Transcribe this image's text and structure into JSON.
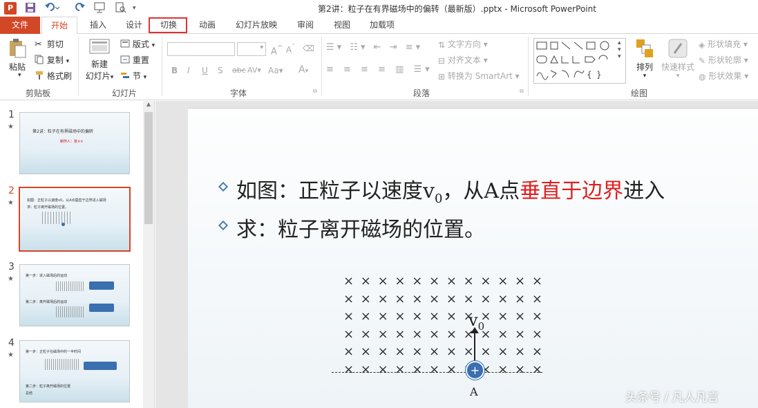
{
  "window": {
    "app_icon_label": "P",
    "title": "第2讲：粒子在有界磁场中的偏转（最新版）.pptx - Microsoft PowerPoint"
  },
  "tabs": [
    "文件",
    "开始",
    "插入",
    "设计",
    "切换",
    "动画",
    "幻灯片放映",
    "审阅",
    "视图",
    "加载项"
  ],
  "ribbon": {
    "clipboard": {
      "paste": "粘贴",
      "cut": "剪切",
      "copy": "复制",
      "format_painter": "格式刷",
      "label": "剪贴板"
    },
    "slides": {
      "new_slide_1": "新建",
      "new_slide_2": "幻灯片",
      "layout": "版式",
      "reset": "重置",
      "section": "节",
      "label": "幻灯片"
    },
    "font": {
      "bold": "B",
      "italic": "I",
      "underline": "U",
      "strike": "S",
      "shadow": "abc",
      "spacing": "AV",
      "case": "Aa",
      "color": "A",
      "grow": "A",
      "shrink": "A",
      "label": "字体"
    },
    "paragraph": {
      "text_direction": "文字方向",
      "align_text": "对齐文本",
      "smartart": "转换为 SmartArt",
      "label": "段落"
    },
    "drawing": {
      "arrange": "排列",
      "quick_styles": "快速样式",
      "fill": "形状填充",
      "outline": "形状轮廓",
      "effects": "形状效果",
      "label": "绘图"
    }
  },
  "thumbnails": [
    {
      "num": "1",
      "title": "第2讲：粒子在有界磁场中的偏转",
      "subtitle": "制作人：张××"
    },
    {
      "num": "2",
      "line1": "如图：正粒子以速度v0，从A点垂直于边界进入磁场",
      "line2": "求：粒子离开磁场的位置。"
    },
    {
      "num": "3",
      "line1": "第一步：进入磁场后的运动",
      "line2": "第二步：离开磁场后的运动"
    },
    {
      "num": "4",
      "line1": "第一步：正粒子在磁场中的一半时间",
      "line2": "第二步：粒子离开磁场的位置",
      "line3": "总结"
    }
  ],
  "slide": {
    "line1_a": "如图：正粒子以速度v",
    "line1_sub": "0",
    "line1_b": "，从A点",
    "line1_red": "垂直于边界",
    "line1_c": "进入",
    "line2": "求：粒子离开磁场的位置。",
    "x_row": "× × × × × ×  × × × × × ×",
    "velocity_label": "v",
    "velocity_sub": "0",
    "charge": "+",
    "point_label": "A"
  },
  "watermark": "头条号 / 凡人凡言",
  "colors": {
    "accent": "#d24726",
    "highlight": "#e53030",
    "bullet": "#4a7fb3",
    "particle": "#3a6fb0",
    "red_text": "#e02020"
  }
}
